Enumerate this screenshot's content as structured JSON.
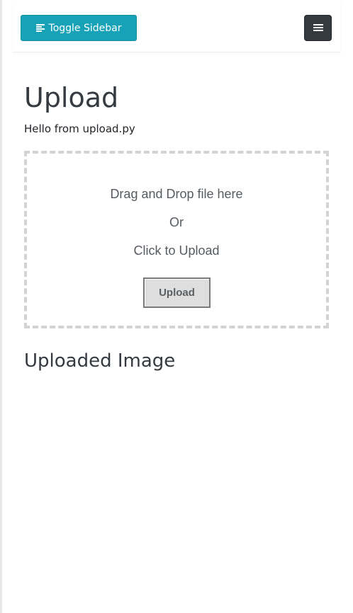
{
  "navbar": {
    "toggle_label": "Toggle Sidebar",
    "toggle_icon": "align-left-icon",
    "menu_icon": "hamburger-icon",
    "toggle_color": "#17a2b8",
    "menu_color": "#343a40"
  },
  "main": {
    "title": "Upload",
    "subtitle": "Hello from upload.py",
    "dropzone": {
      "line1": "Drag and Drop file here",
      "line2": "Or",
      "line3": "Click to Upload",
      "button_label": "Upload"
    },
    "uploaded_title": "Uploaded Image"
  }
}
